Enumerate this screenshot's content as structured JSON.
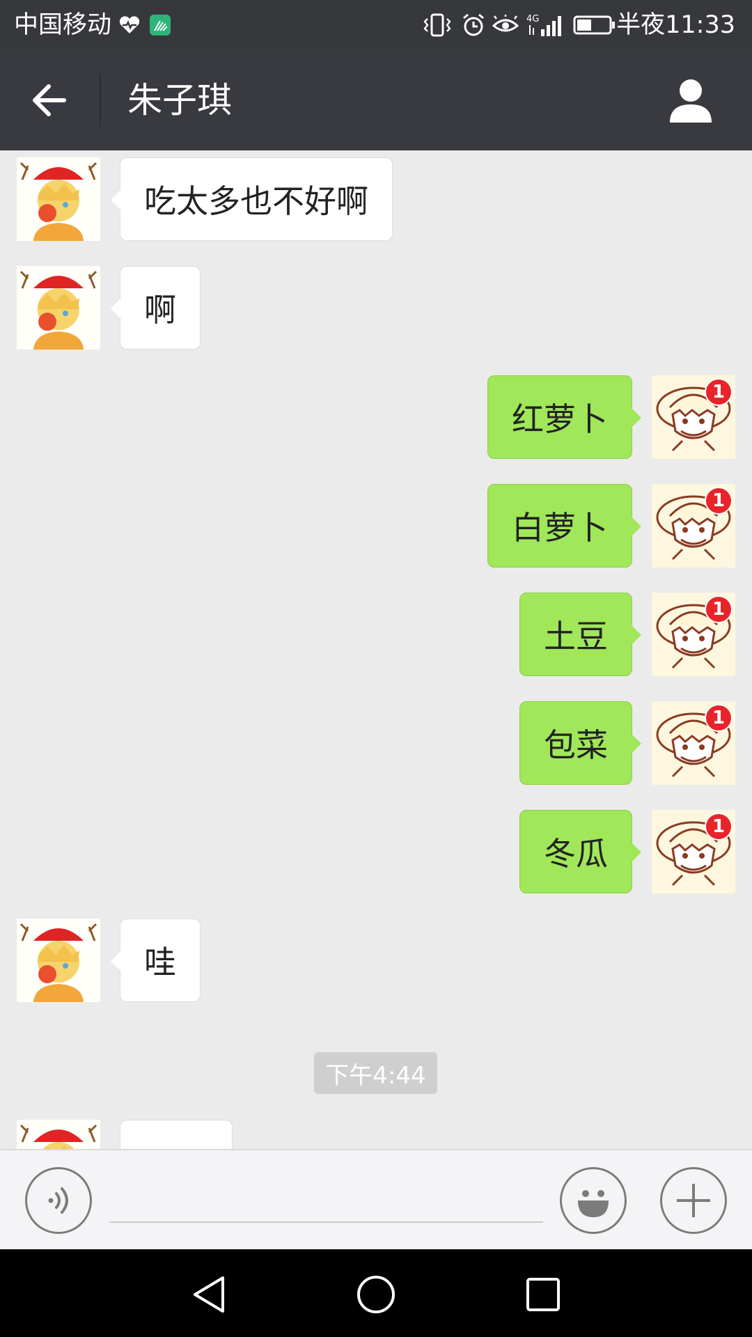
{
  "status_bar": {
    "carrier": "中国移动",
    "network": "4G",
    "time": "半夜11:33",
    "icons": [
      "heart-monitor-icon",
      "app-notification-icon",
      "vibrate-icon",
      "alarm-icon",
      "eye-comfort-icon",
      "signal-icon",
      "battery-icon"
    ]
  },
  "header": {
    "title": "朱子琪",
    "back_icon": "arrow-left-icon",
    "contact_icon": "person-icon"
  },
  "messages": [
    {
      "side": "left",
      "text": "吃太多也不好啊"
    },
    {
      "side": "left",
      "text": "啊"
    },
    {
      "side": "right",
      "text": "红萝卜",
      "badge": "1"
    },
    {
      "side": "right",
      "text": "白萝卜",
      "badge": "1"
    },
    {
      "side": "right",
      "text": "土豆",
      "badge": "1"
    },
    {
      "side": "right",
      "text": "包菜",
      "badge": "1"
    },
    {
      "side": "right",
      "text": "冬瓜",
      "badge": "1"
    },
    {
      "side": "left",
      "text": "哇"
    },
    {
      "side": "left",
      "text": "……"
    }
  ],
  "timestamp": "下午4:44",
  "input_bar": {
    "value": "",
    "voice_icon": "voice-icon",
    "emoji_icon": "emoji-icon",
    "more_icon": "plus-icon"
  },
  "nav_bar": {
    "icons": [
      "nav-back-icon",
      "nav-home-icon",
      "nav-recents-icon"
    ]
  },
  "colors": {
    "header_bg": "#393a3f",
    "chat_bg": "#ebebeb",
    "sent_bubble": "#a0e75a",
    "received_bubble": "#ffffff",
    "badge": "#e8242a"
  }
}
